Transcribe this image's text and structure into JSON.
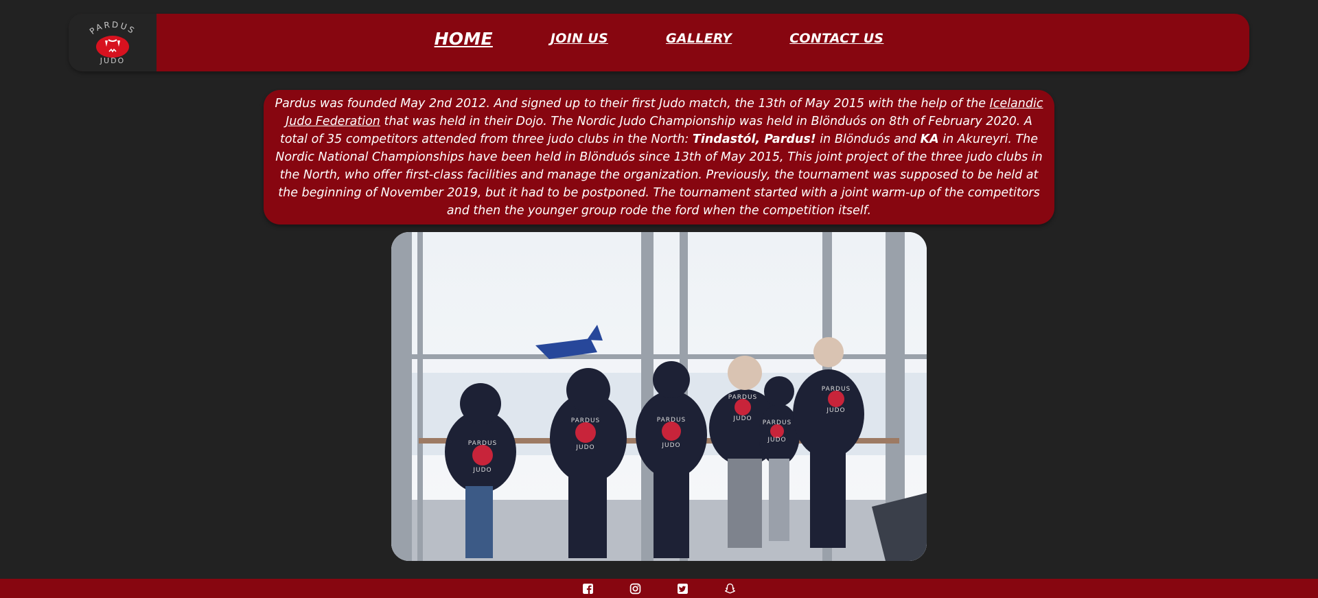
{
  "header": {
    "logo": {
      "top_text": "PARDUS",
      "bottom_text": "JUDO"
    },
    "nav": [
      {
        "label": "HOME",
        "active": true
      },
      {
        "label": "JOIN US"
      },
      {
        "label": "GALLERY"
      },
      {
        "label": "CONTACT US"
      }
    ]
  },
  "about": {
    "p1": "Pardus was founded May 2nd 2012. And signed up to their first Judo match, the 13th of May 2015 with the help of the ",
    "link": "Icelandic Judo Federation",
    "p2": " that was held in their Dojo. The Nordic Judo Championship was held in Blönduós on 8th of February 2020. A total of 35 competitors attended from three judo clubs in the North: ",
    "club1": "Tindastól",
    "sep": ", ",
    "club2": "Pardus!",
    "p3": " in Blönduós and ",
    "club3": "KA",
    "p4": " in Akureyri. The Nordic National Championships have been held in Blönduós since 13th of May 2015, This joint project of the three judo clubs in the North, who offer first-class facilities and manage the organization. Previously, the tournament was supposed to be held at the beginning of November 2019, but it had to be postponed. The tournament started with a joint warm-up of the competitors and then the younger group rode the ford when the competition itself."
  },
  "photo": {
    "hoodie_top": "PARDUS",
    "hoodie_bottom": "JUDO"
  },
  "footer": {
    "icons": [
      "facebook-icon",
      "instagram-icon",
      "twitter-icon",
      "snapchat-icon"
    ]
  },
  "colors": {
    "background": "#222222",
    "brand_red": "#870610",
    "logo_red": "#d7121f",
    "text": "#ffffff"
  }
}
